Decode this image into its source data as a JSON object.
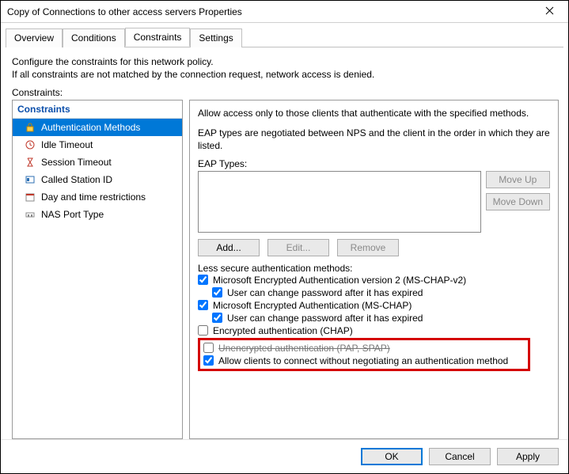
{
  "window": {
    "title": "Copy of Connections to other access servers Properties"
  },
  "tabs": {
    "overview": "Overview",
    "conditions": "Conditions",
    "constraints": "Constraints",
    "settings": "Settings",
    "active": "constraints"
  },
  "descr": {
    "line1": "Configure the constraints for this network policy.",
    "line2": "If all constraints are not matched by the connection request, network access is denied."
  },
  "sidebar": {
    "heading": "Constraints",
    "label": "Constraints:",
    "items": [
      {
        "key": "auth",
        "label": "Authentication Methods",
        "selected": true
      },
      {
        "key": "idle",
        "label": "Idle Timeout",
        "selected": false
      },
      {
        "key": "session",
        "label": "Session Timeout",
        "selected": false
      },
      {
        "key": "called",
        "label": "Called Station ID",
        "selected": false
      },
      {
        "key": "time",
        "label": "Day and time restrictions",
        "selected": false
      },
      {
        "key": "nas",
        "label": "NAS Port Type",
        "selected": false
      }
    ]
  },
  "panel": {
    "intro": "Allow access only to those clients that authenticate with the specified methods.",
    "eap_note": "EAP types are negotiated between NPS and the client in the order in which they are listed.",
    "eap_label": "EAP Types:",
    "move_up": "Move Up",
    "move_down": "Move Down",
    "add": "Add...",
    "edit": "Edit...",
    "remove": "Remove",
    "less_secure": "Less secure authentication methods:",
    "checks": {
      "mschap2": {
        "label": "Microsoft Encrypted Authentication version 2 (MS-CHAP-v2)",
        "checked": true
      },
      "mschap2_pw": {
        "label": "User can change password after it has expired",
        "checked": true
      },
      "mschap": {
        "label": "Microsoft Encrypted Authentication (MS-CHAP)",
        "checked": true
      },
      "mschap_pw": {
        "label": "User can change password after it has expired",
        "checked": true
      },
      "chap": {
        "label": "Encrypted authentication (CHAP)",
        "checked": false
      },
      "pap": {
        "label": "Unencrypted authentication (PAP, SPAP)",
        "checked": false
      },
      "allow_no_auth": {
        "label": "Allow clients to connect without negotiating an authentication method",
        "checked": true
      }
    }
  },
  "footer": {
    "ok": "OK",
    "cancel": "Cancel",
    "apply": "Apply"
  }
}
